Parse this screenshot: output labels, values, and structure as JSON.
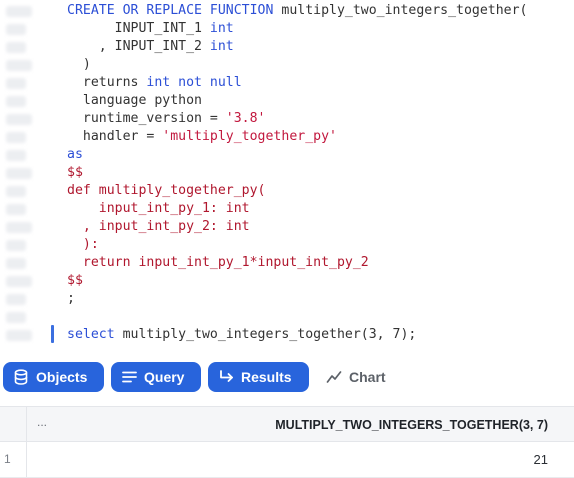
{
  "editor": {
    "lines": [
      [
        {
          "t": "CREATE OR REPLACE FUNCTION ",
          "c": "kw"
        },
        {
          "t": "multiply_two_integers_together(",
          "c": ""
        }
      ],
      [
        {
          "t": "      INPUT_INT_1 ",
          "c": ""
        },
        {
          "t": "int",
          "c": "kw"
        }
      ],
      [
        {
          "t": "    , INPUT_INT_2 ",
          "c": ""
        },
        {
          "t": "int",
          "c": "kw"
        }
      ],
      [
        {
          "t": "  )",
          "c": ""
        }
      ],
      [
        {
          "t": "  returns ",
          "c": ""
        },
        {
          "t": "int not null",
          "c": "kw"
        }
      ],
      [
        {
          "t": "  language python",
          "c": ""
        }
      ],
      [
        {
          "t": "  runtime_version = ",
          "c": ""
        },
        {
          "t": "'3.8'",
          "c": "str"
        }
      ],
      [
        {
          "t": "  handler = ",
          "c": ""
        },
        {
          "t": "'multiply_together_py'",
          "c": "str"
        }
      ],
      [
        {
          "t": "as",
          "c": "kw"
        }
      ],
      [
        {
          "t": "$$",
          "c": "red"
        }
      ],
      [
        {
          "t": "def multiply_together_py(",
          "c": "red"
        }
      ],
      [
        {
          "t": "    input_int_py_1: int",
          "c": "red"
        }
      ],
      [
        {
          "t": "  , input_int_py_2: int",
          "c": "red"
        }
      ],
      [
        {
          "t": "  ):",
          "c": "red"
        }
      ],
      [
        {
          "t": "  return input_int_py_1*input_int_py_2",
          "c": "red"
        }
      ],
      [
        {
          "t": "$$",
          "c": "red"
        }
      ],
      [
        {
          "t": ";",
          "c": ""
        }
      ],
      [
        {
          "t": "",
          "c": ""
        }
      ],
      [
        {
          "t": "select ",
          "c": "kw"
        },
        {
          "t": "multiply_two_integers_together(3, 7);",
          "c": ""
        }
      ]
    ]
  },
  "tabs": {
    "objects": "Objects",
    "query": "Query",
    "results": "Results",
    "chart": "Chart"
  },
  "results": {
    "header_menu": "...",
    "column": "MULTIPLY_TWO_INTEGERS_TOGETHER(3, 7)",
    "rows": [
      {
        "num": "1",
        "value": "21"
      }
    ]
  }
}
